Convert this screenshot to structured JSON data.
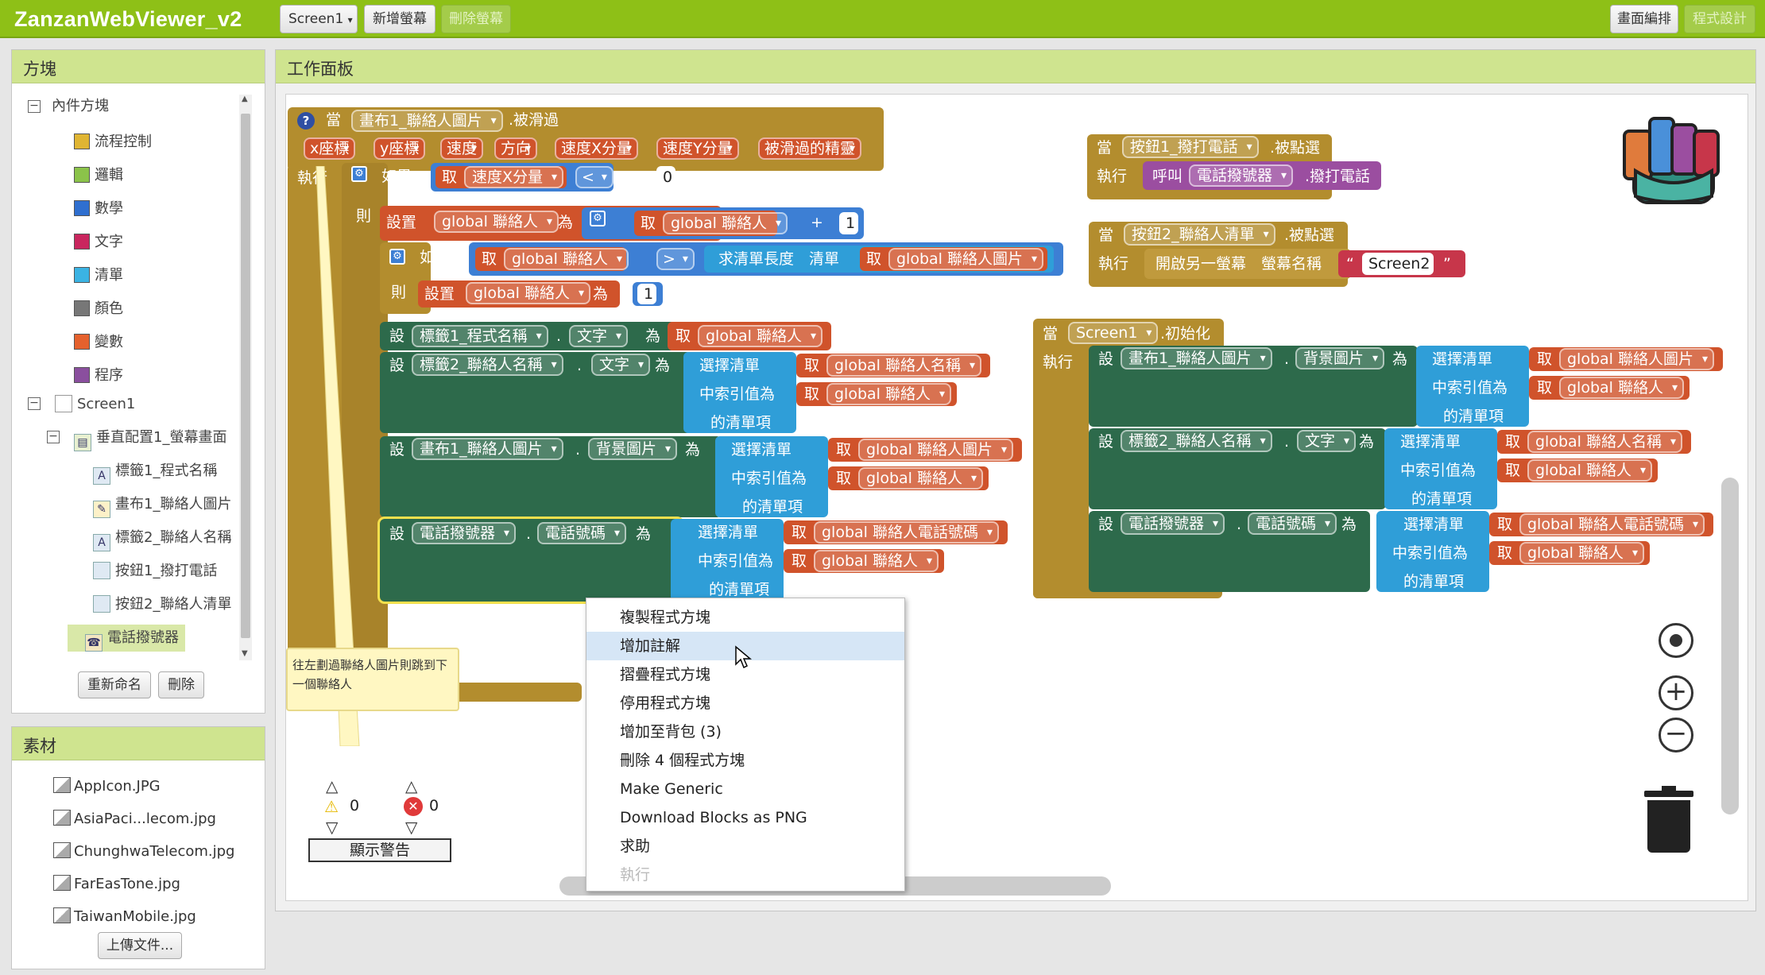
{
  "app": {
    "title": "ZanzanWebViewer_v2"
  },
  "toolbar": {
    "screen_select": "Screen1",
    "add_screen": "新增螢幕",
    "remove_screen": "刪除螢幕",
    "designer": "畫面編排",
    "blocks": "程式設計"
  },
  "blocks_panel": {
    "title": "方塊",
    "builtin": "內件方塊",
    "items": [
      "流程控制",
      "邏輯",
      "數學",
      "文字",
      "清單",
      "顏色",
      "變數",
      "程序"
    ],
    "screen": "Screen1",
    "arrangement": "垂直配置1_螢幕畫面",
    "components": [
      "標籤1_程式名稱",
      "畫布1_聯絡人圖片",
      "標籤2_聯絡人名稱",
      "按鈕1_撥打電話",
      "按鈕2_聯絡人清單",
      "電話撥號器"
    ],
    "rename": "重新命名",
    "delete": "刪除"
  },
  "media_panel": {
    "title": "素材",
    "files": [
      "AppIcon.JPG",
      "AsiaPaci...lecom.jpg",
      "ChunghwaTelecom.jpg",
      "FarEasTone.jpg",
      "TaiwanMobile.jpg"
    ],
    "upload": "上傳文件..."
  },
  "workspace": {
    "title": "工作面板",
    "warnings": "0",
    "errors": "0",
    "show_warnings": "顯示警告",
    "comment": "往左劃過聯絡人圖片則跳到下一個聯絡人"
  },
  "blk": {
    "when": "當",
    "do": "執行",
    "if": "如果",
    "then": "則",
    "set_var": "設置",
    "to": "為",
    "set": "設",
    "get": "取",
    "call": "呼叫",
    "canvas": "畫布1_聯絡人圖片",
    "flung": ".被滑過",
    "params": [
      "x座標",
      "y座標",
      "速度",
      "方向",
      "速度X分量",
      "速度Y分量",
      "被滑過的精靈"
    ],
    "speedx": "速度X分量",
    "lt": "<",
    "gt": ">",
    "zero": "0",
    "one": "1",
    "plus": "+",
    "g_contact": "global 聯絡人",
    "g_img": "global 聯絡人圖片",
    "g_name": "global 聯絡人名稱",
    "g_phone": "global 聯絡人電話號碼",
    "list_len": "求清單長度　清單",
    "label1": "標籤1_程式名稱",
    "label2": "標籤2_聯絡人名稱",
    "text": "文字",
    "bgimg": "背景圖片",
    "dialer": "電話撥號器",
    "phone": "電話號碼",
    "sel1": "選擇清單",
    "sel2": "中索引值為",
    "sel3": "的清單項",
    "btn1": "按鈕1_撥打電話",
    "btn2": "按鈕2_聯絡人清單",
    "click": ".被點選",
    "makecall": ".撥打電話",
    "open_screen": "開啟另一螢幕　螢幕名稱",
    "q1": "“",
    "screen2": "Screen2",
    "q2": "”",
    "screen1": "Screen1",
    "init": ".初始化",
    "dot": "."
  },
  "context_menu": {
    "items": [
      "複製程式方塊",
      "增加註解",
      "摺疊程式方塊",
      "停用程式方塊",
      "增加至背包 (3)",
      "刪除 4 個程式方塊",
      "Make Generic",
      "Download Blocks as PNG",
      "求助",
      "執行"
    ]
  },
  "colors": {
    "topbar": "#8ec017",
    "panel_header": "#cfe48f",
    "event": "#b38d2e",
    "component": "#2d6a4b",
    "list": "#2f9ed8",
    "variable": "#d0532b"
  }
}
